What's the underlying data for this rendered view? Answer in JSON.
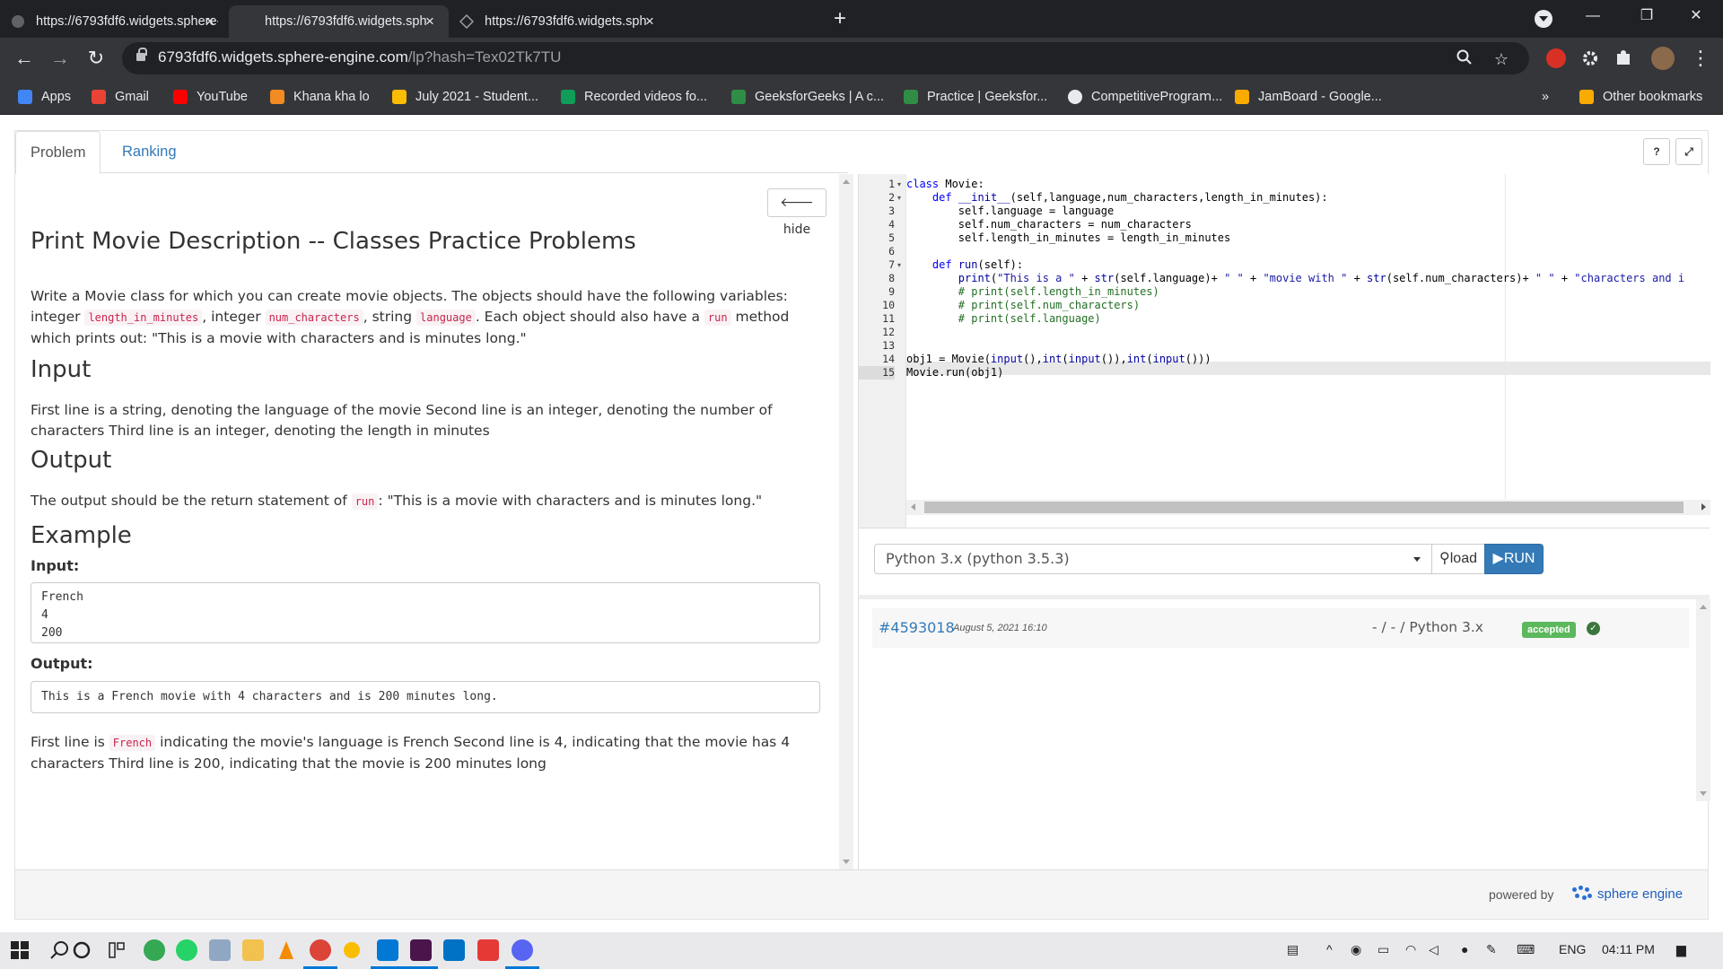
{
  "browser": {
    "tabs": [
      {
        "title": "https://6793fdf6.widgets.sphere-",
        "active": false
      },
      {
        "title": "https://6793fdf6.widgets.sphere-",
        "active": true
      },
      {
        "title": "https://6793fdf6.widgets.sphere-",
        "active": false
      }
    ],
    "close_glyph": "×",
    "new_tab_glyph": "+",
    "url_host": "6793fdf6.widgets.sphere-engine.com",
    "url_path": "/lp?hash=Tex02Tk7TU",
    "bookmarks": [
      {
        "label": "Apps",
        "icon": "apps-grid-icon",
        "color": "#4285f4"
      },
      {
        "label": "Gmail",
        "icon": "gmail-icon",
        "color": "#ea4335"
      },
      {
        "label": "YouTube",
        "icon": "youtube-icon",
        "color": "#ff0000"
      },
      {
        "label": "Khana kha lo",
        "icon": "food-icon",
        "color": "#f28b22"
      },
      {
        "label": "July 2021 - Student...",
        "icon": "drive-icon",
        "color": "#fbbc04"
      },
      {
        "label": "Recorded videos fo...",
        "icon": "drive-icon",
        "color": "#0f9d58"
      },
      {
        "label": "GeeksforGeeks | A c...",
        "icon": "gfg-icon",
        "color": "#2f8d46"
      },
      {
        "label": "Practice | Geeksfor...",
        "icon": "gfg-icon",
        "color": "#2f8d46"
      },
      {
        "label": "CompetitivePrograⅿ...",
        "icon": "github-icon",
        "color": "#e8eaed"
      },
      {
        "label": "JamBoard - Google...",
        "icon": "jamboard-icon",
        "color": "#f9ab00"
      }
    ],
    "more_bookmarks": "»",
    "other_bookmarks": "Other bookmarks"
  },
  "widget": {
    "tabs": [
      "Problem",
      "Ranking"
    ],
    "help_label": "?",
    "expand_label": "⤢",
    "hide_label": "hide",
    "title": "Print Movie Description -- Classes Practice Problems",
    "description": {
      "p1": "Write a Movie class for which you can create movie objects. The objects should have the following variables: integer",
      "c1": "length_in_minutes",
      "p2": ", integer",
      "c2": "num_characters",
      "p3": ", string",
      "c3": "language",
      "p4": ". Each object should also have a",
      "c4": "run",
      "p5": "method which prints",
      "p6": "out: \"This is a movie with characters and is minutes long.\""
    },
    "input_heading": "Input",
    "input_text": "First line is a string, denoting the language of the movie Second line is an integer, denoting the number of characters Third line is an integer, denoting the length in minutes",
    "output_heading": "Output",
    "output_text_pre": "The output should be the return statement of",
    "output_code": "run",
    "output_text_post": ": \"This is a movie with characters and is minutes long.\"",
    "example_heading": "Example",
    "example_input_label": "Input:",
    "example_input": "French\n4\n200",
    "example_output_label": "Output:",
    "example_output": "This is a French movie with 4 characters and is 200 minutes long.",
    "explanation_pre": "First line is",
    "explanation_code": "French",
    "explanation_post": "indicating the movie's language is French Second line is 4, indicating that the movie has 4 characters Third line is 200, indicating that the movie is 200 minutes long"
  },
  "editor": {
    "line_numbers": [
      "1",
      "2",
      "3",
      "4",
      "5",
      "6",
      "7",
      "8",
      "9",
      "10",
      "11",
      "12",
      "13",
      "14",
      "15"
    ],
    "active_line": 15
  },
  "runbar": {
    "language": "Python 3.x (python 3.5.3)",
    "load_label": "load",
    "run_label": "RUN"
  },
  "submission": {
    "id": "#4593018",
    "date": "August 5, 2021 16:10",
    "lang": "- / - / Python 3.x",
    "status": "accepted"
  },
  "footer": {
    "powered_by": "powered by",
    "brand": "sphere engine"
  },
  "taskbar": {
    "lang": "ENG",
    "time": "04:11 PM"
  },
  "colors": {
    "link": "#337ab7",
    "run_button": "#337ab7",
    "accepted": "#5cb85c"
  }
}
